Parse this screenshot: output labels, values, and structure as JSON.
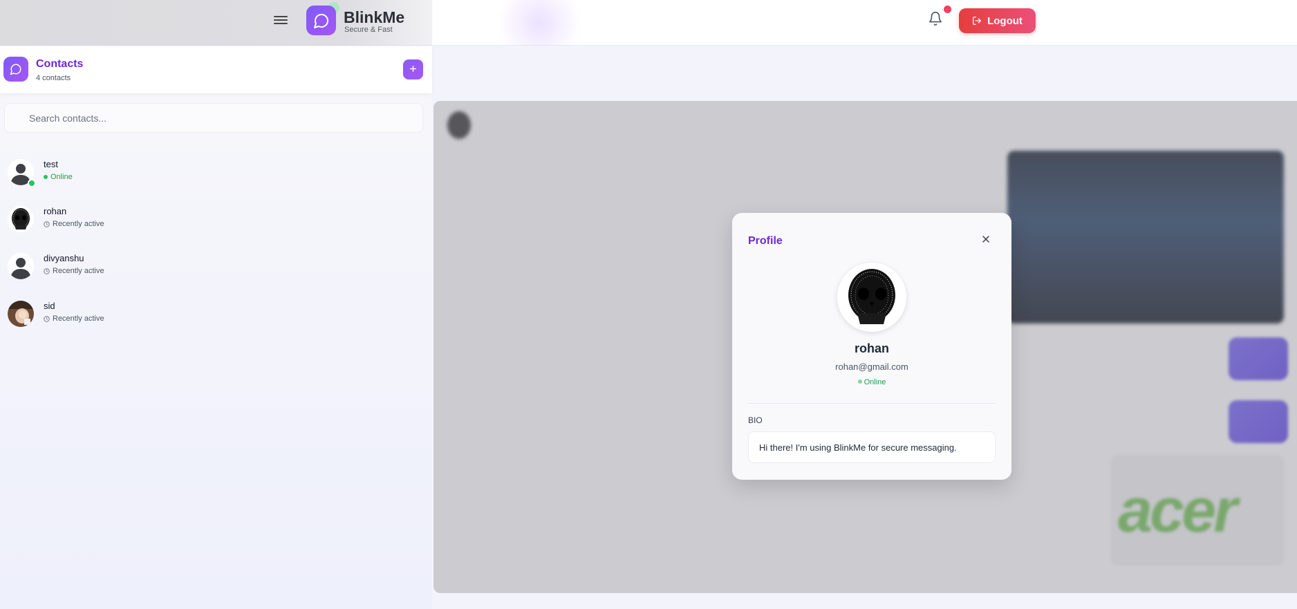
{
  "header": {
    "brand_name": "BlinkMe",
    "brand_tagline": "Secure & Fast",
    "logout_label": "Logout"
  },
  "sidebar": {
    "title": "Contacts",
    "count_label": "4 contacts",
    "search": {
      "placeholder": "Search contacts...",
      "value": ""
    },
    "contacts": [
      {
        "name": "test",
        "status": "Online",
        "online": true,
        "avatar": "default-avatar"
      },
      {
        "name": "rohan",
        "status": "Recently active",
        "online": false,
        "avatar": "skull-sketch-avatar"
      },
      {
        "name": "divyanshu",
        "status": "Recently active",
        "online": false,
        "avatar": "default-avatar"
      },
      {
        "name": "sid",
        "status": "Recently active",
        "online": false,
        "avatar": "photo-avatar"
      }
    ]
  },
  "profile_modal": {
    "title": "Profile",
    "name": "rohan",
    "email": "rohan@gmail.com",
    "status": "Online",
    "bio_label": "BIO",
    "bio": "Hi there! I'm using BlinkMe for secure messaging."
  },
  "colors": {
    "accent": "#7c3aed",
    "logout_start": "#e53e3e",
    "logout_end": "#ec4f7a",
    "online": "#22c55e"
  },
  "icons": {
    "menu": "hamburger-icon",
    "logo": "chat-bubble-icon",
    "notification": "bell-icon",
    "logout": "logout-icon",
    "add": "plus-icon",
    "close": "close-icon",
    "clock": "clock-icon"
  }
}
